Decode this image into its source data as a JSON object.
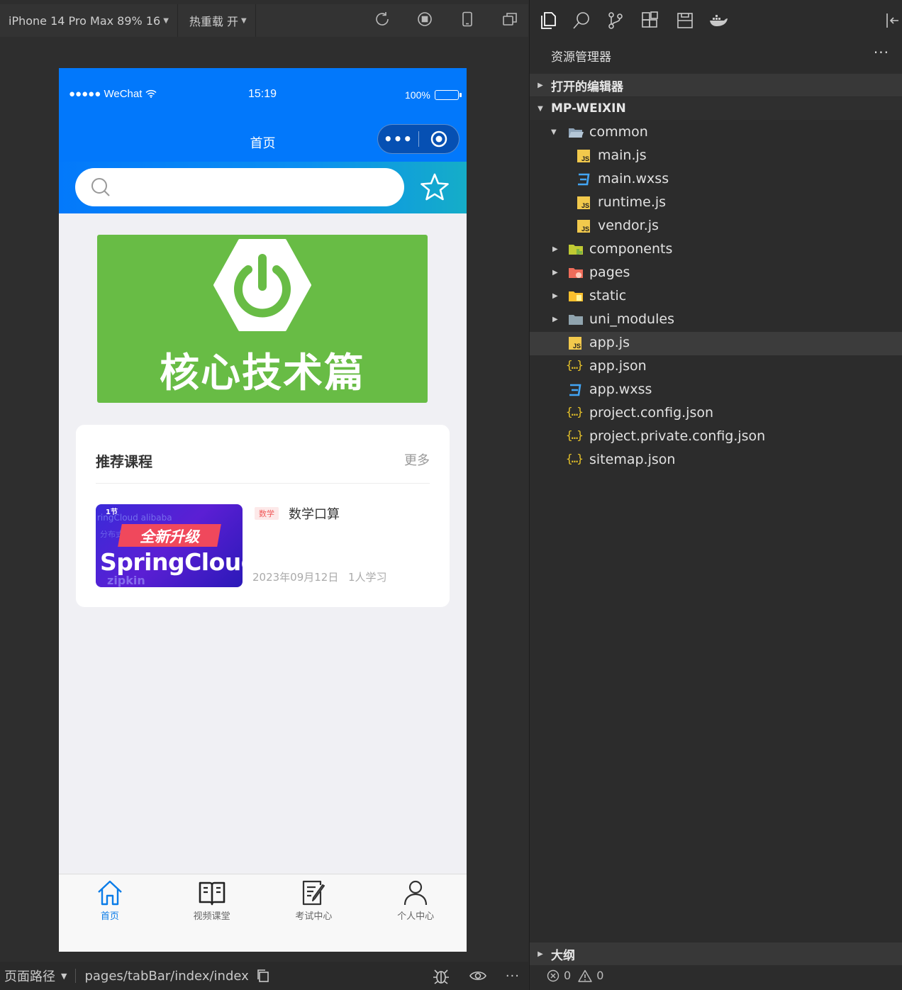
{
  "toolbar": {
    "device_label": "iPhone 14 Pro Max 89% 16",
    "hot_reload_label": "热重载 开"
  },
  "phone": {
    "status_bar": {
      "carrier": "●●●●● WeChat",
      "time": "15:19",
      "battery": "100%"
    },
    "nav_title": "首页",
    "capsule_more": "•••",
    "banner_text": "核心技术篇",
    "recommend": {
      "title": "推荐课程",
      "more": "更多",
      "course": {
        "thumb_episode": "1节",
        "thumb_bg_text_1": "ringCloud alibaba",
        "thumb_bg_text_2": "分布式",
        "thumb_bg_text_3": "zipkin",
        "thumb_badge": "全新升级",
        "thumb_title": "SpringCloud",
        "tag": "数学",
        "name": "数学口算",
        "date": "2023年09月12日",
        "learners": "1人学习"
      }
    },
    "tabs": [
      {
        "label": "首页",
        "icon": "home-icon",
        "active": true
      },
      {
        "label": "视频课堂",
        "icon": "book-icon",
        "active": false
      },
      {
        "label": "考试中心",
        "icon": "exam-icon",
        "active": false
      },
      {
        "label": "个人中心",
        "icon": "person-icon",
        "active": false
      }
    ],
    "colors": {
      "primary": "#0278fb",
      "banner": "#68bc45",
      "tab_active": "#0a7ce8"
    }
  },
  "bottom_bar": {
    "page_path_label": "页面路径",
    "page_path": "pages/tabBar/index/index"
  },
  "explorer": {
    "title": "资源管理器",
    "menu": "···",
    "open_editors": "打开的编辑器",
    "project": "MP-WEIXIN",
    "tree": [
      {
        "name": "common",
        "type": "folder-open"
      },
      {
        "name": "main.js",
        "type": "js"
      },
      {
        "name": "main.wxss",
        "type": "css"
      },
      {
        "name": "runtime.js",
        "type": "js"
      },
      {
        "name": "vendor.js",
        "type": "js"
      },
      {
        "name": "components",
        "type": "folder"
      },
      {
        "name": "pages",
        "type": "folder"
      },
      {
        "name": "static",
        "type": "folder"
      },
      {
        "name": "uni_modules",
        "type": "folder"
      },
      {
        "name": "app.js",
        "type": "js",
        "selected": true
      },
      {
        "name": "app.json",
        "type": "json"
      },
      {
        "name": "app.wxss",
        "type": "css"
      },
      {
        "name": "project.config.json",
        "type": "json"
      },
      {
        "name": "project.private.config.json",
        "type": "json"
      },
      {
        "name": "sitemap.json",
        "type": "json"
      }
    ],
    "outline": "大纲",
    "errors": "0",
    "warnings": "0"
  }
}
